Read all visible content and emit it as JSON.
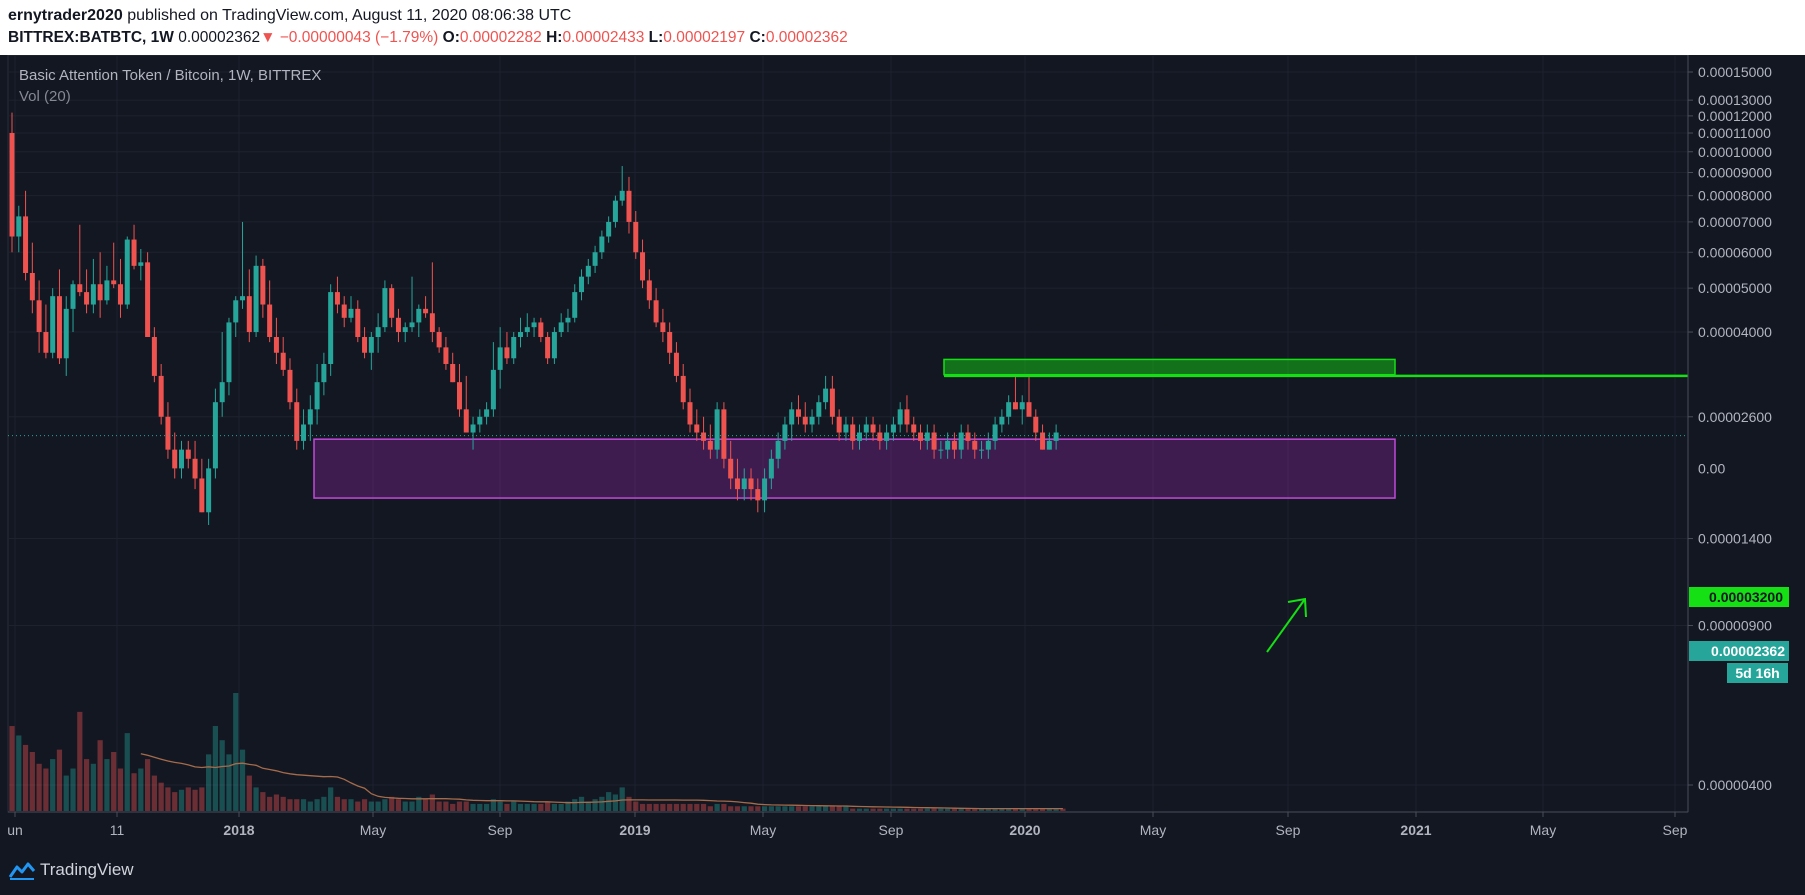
{
  "header": {
    "author": "ernytrader2020",
    "published_text": "published on TradingView.com, August 11, 2020 08:06:38 UTC",
    "symbol": "BITTREX:BATBTC, 1W",
    "price": "0.00002362",
    "change": "▼ −0.00000043 (−1.79%)",
    "open_label": "O:",
    "open": "0.00002282",
    "high_label": "H:",
    "high": "0.00002433",
    "low_label": "L:",
    "low": "0.00002197",
    "close_label": "C:",
    "close": "0.00002362"
  },
  "legend": {
    "title": "Basic Attention Token / Bitcoin, 1W, BITTREX",
    "volume": "Vol (20)"
  },
  "footer": {
    "brand": "TradingView",
    "icon": "tradingview-logo-icon"
  },
  "colors": {
    "up": "#26a69a",
    "down": "#ef5350",
    "resistance": "#14e014",
    "support_zone": "#9c27b0",
    "background": "#131722"
  },
  "chart_data": {
    "type": "candlestick",
    "scale": "log",
    "price_ticks": [
      "0.00015000",
      "0.00013000",
      "0.00012000",
      "0.00011000",
      "0.00010000",
      "0.00009000",
      "0.00008000",
      "0.00007000",
      "0.00006000",
      "0.00005000",
      "0.00004000",
      "0.00002600",
      "0.00001400",
      "0.00000900",
      "0.00000400"
    ],
    "time_ticks": [
      "un",
      "11",
      "2018",
      "May",
      "Sep",
      "2019",
      "May",
      "Sep",
      "2020",
      "May",
      "Sep",
      "2021",
      "May",
      "Sep"
    ],
    "last_price": "0.00002362",
    "countdown": "5d 16h",
    "resistance_level": "0.00003200",
    "support_zone": [
      1.72e-05,
      2.32e-05
    ],
    "resistance_zone": [
      3.22e-05,
      3.48e-05
    ],
    "candles": [
      [
        0.00011,
        0.000122,
        6e-05,
        6.5e-05
      ],
      [
        6.5e-05,
        7.6e-05,
        6e-05,
        7.2e-05
      ],
      [
        7.2e-05,
        8.2e-05,
        5.2e-05,
        5.4e-05
      ],
      [
        5.4e-05,
        6.3e-05,
        4.4e-05,
        4.7e-05
      ],
      [
        4.7e-05,
        5.2e-05,
        3.6e-05,
        4e-05
      ],
      [
        4e-05,
        4.6e-05,
        3.5e-05,
        3.6e-05
      ],
      [
        3.6e-05,
        5e-05,
        3.5e-05,
        4.8e-05
      ],
      [
        4.8e-05,
        5.5e-05,
        3.4e-05,
        3.5e-05
      ],
      [
        3.5e-05,
        4.8e-05,
        3.2e-05,
        4.5e-05
      ],
      [
        4.5e-05,
        5.2e-05,
        4e-05,
        5.1e-05
      ],
      [
        5.1e-05,
        6.9e-05,
        4.8e-05,
        4.9e-05
      ],
      [
        4.9e-05,
        5.5e-05,
        4.4e-05,
        4.6e-05
      ],
      [
        4.6e-05,
        5.8e-05,
        4.4e-05,
        5.1e-05
      ],
      [
        5.1e-05,
        6e-05,
        4.3e-05,
        4.7e-05
      ],
      [
        4.7e-05,
        5.6e-05,
        4.6e-05,
        5.2e-05
      ],
      [
        5.2e-05,
        6.3e-05,
        5e-05,
        5.1e-05
      ],
      [
        5.1e-05,
        5.8e-05,
        4.3e-05,
        4.6e-05
      ],
      [
        4.6e-05,
        6.5e-05,
        4.5e-05,
        6.4e-05
      ],
      [
        6.4e-05,
        6.9e-05,
        5.5e-05,
        5.6e-05
      ],
      [
        5.6e-05,
        6.1e-05,
        5.2e-05,
        5.7e-05
      ],
      [
        5.7e-05,
        6e-05,
        4.5e-05,
        3.9e-05
      ],
      [
        3.9e-05,
        4.1e-05,
        3.1e-05,
        3.2e-05
      ],
      [
        3.2e-05,
        3.4e-05,
        2.5e-05,
        2.6e-05
      ],
      [
        2.6e-05,
        2.8e-05,
        2.1e-05,
        2.2e-05
      ],
      [
        2.2e-05,
        2.4e-05,
        1.9e-05,
        2e-05
      ],
      [
        2e-05,
        2.3e-05,
        1.9e-05,
        2.2e-05
      ],
      [
        2.2e-05,
        2.3e-05,
        2e-05,
        2.1e-05
      ],
      [
        2.1e-05,
        2.3e-05,
        1.8e-05,
        1.9e-05
      ],
      [
        1.9e-05,
        2.1e-05,
        1.6e-05,
        1.6e-05
      ],
      [
        1.6e-05,
        2.1e-05,
        1.5e-05,
        2e-05
      ],
      [
        2e-05,
        3e-05,
        1.9e-05,
        2.8e-05
      ],
      [
        2.8e-05,
        4e-05,
        2.6e-05,
        3.1e-05
      ],
      [
        3.1e-05,
        4.3e-05,
        2.9e-05,
        4.2e-05
      ],
      [
        4.2e-05,
        4.8e-05,
        3.9e-05,
        4.7e-05
      ],
      [
        4.7e-05,
        7e-05,
        4.5e-05,
        4.8e-05
      ],
      [
        4.8e-05,
        5.5e-05,
        3.8e-05,
        4e-05
      ],
      [
        4e-05,
        5.9e-05,
        3.9e-05,
        5.6e-05
      ],
      [
        5.6e-05,
        5.8e-05,
        4.3e-05,
        4.6e-05
      ],
      [
        4.6e-05,
        5.2e-05,
        3.8e-05,
        3.9e-05
      ],
      [
        3.9e-05,
        4.3e-05,
        3.4e-05,
        3.6e-05
      ],
      [
        3.6e-05,
        3.9e-05,
        3.2e-05,
        3.3e-05
      ],
      [
        3.3e-05,
        3.5e-05,
        2.7e-05,
        2.8e-05
      ],
      [
        2.8e-05,
        3e-05,
        2.2e-05,
        2.3e-05
      ],
      [
        2.3e-05,
        2.7e-05,
        2.2e-05,
        2.5e-05
      ],
      [
        2.5e-05,
        2.9e-05,
        2.3e-05,
        2.7e-05
      ],
      [
        2.7e-05,
        3.4e-05,
        2.5e-05,
        3.1e-05
      ],
      [
        3.1e-05,
        3.6e-05,
        2.9e-05,
        3.4e-05
      ],
      [
        3.4e-05,
        5.1e-05,
        3.2e-05,
        4.9e-05
      ],
      [
        4.9e-05,
        5.3e-05,
        4.4e-05,
        4.6e-05
      ],
      [
        4.6e-05,
        4.8e-05,
        4.1e-05,
        4.3e-05
      ],
      [
        4.3e-05,
        4.8e-05,
        4.2e-05,
        4.5e-05
      ],
      [
        4.5e-05,
        4.7e-05,
        3.8e-05,
        3.9e-05
      ],
      [
        3.9e-05,
        4.1e-05,
        3.5e-05,
        3.6e-05
      ],
      [
        3.6e-05,
        4e-05,
        3.3e-05,
        3.9e-05
      ],
      [
        3.9e-05,
        4.4e-05,
        3.6e-05,
        4.1e-05
      ],
      [
        4.1e-05,
        5.2e-05,
        4e-05,
        5e-05
      ],
      [
        5e-05,
        5.1e-05,
        4.1e-05,
        4.3e-05
      ],
      [
        4.3e-05,
        4.5e-05,
        3.8e-05,
        4e-05
      ],
      [
        4e-05,
        4.2e-05,
        3.8e-05,
        4.1e-05
      ],
      [
        4.1e-05,
        5.3e-05,
        4e-05,
        4.2e-05
      ],
      [
        4.2e-05,
        4.6e-05,
        3.9e-05,
        4.5e-05
      ],
      [
        4.5e-05,
        4.8e-05,
        4.3e-05,
        4.4e-05
      ],
      [
        4.4e-05,
        5.7e-05,
        3.8e-05,
        4e-05
      ],
      [
        4e-05,
        4.1e-05,
        3.6e-05,
        3.7e-05
      ],
      [
        3.7e-05,
        3.9e-05,
        3.3e-05,
        3.4e-05
      ],
      [
        3.4e-05,
        3.6e-05,
        3.1e-05,
        3.1e-05
      ],
      [
        3.1e-05,
        3.4e-05,
        2.6e-05,
        2.7e-05
      ],
      [
        2.7e-05,
        3.2e-05,
        2.5e-05,
        2.4e-05
      ],
      [
        2.4e-05,
        2.6e-05,
        2.2e-05,
        2.5e-05
      ],
      [
        2.5e-05,
        2.7e-05,
        2.4e-05,
        2.6e-05
      ],
      [
        2.6e-05,
        2.8e-05,
        2.5e-05,
        2.7e-05
      ],
      [
        2.7e-05,
        3.8e-05,
        2.6e-05,
        3.3e-05
      ],
      [
        3.3e-05,
        4.1e-05,
        3e-05,
        3.7e-05
      ],
      [
        3.7e-05,
        4e-05,
        3.4e-05,
        3.5e-05
      ],
      [
        3.5e-05,
        4e-05,
        3.4e-05,
        3.9e-05
      ],
      [
        3.9e-05,
        4.3e-05,
        3.7e-05,
        4e-05
      ],
      [
        4e-05,
        4.4e-05,
        3.9e-05,
        4.1e-05
      ],
      [
        4.1e-05,
        4.3e-05,
        3.9e-05,
        4.2e-05
      ],
      [
        4.2e-05,
        4.3e-05,
        3.8e-05,
        3.9e-05
      ],
      [
        3.9e-05,
        4e-05,
        3.4e-05,
        3.5e-05
      ],
      [
        3.5e-05,
        4.1e-05,
        3.4e-05,
        4e-05
      ],
      [
        4e-05,
        4.4e-05,
        3.9e-05,
        4.2e-05
      ],
      [
        4.2e-05,
        4.5e-05,
        4e-05,
        4.3e-05
      ],
      [
        4.3e-05,
        5.1e-05,
        4.2e-05,
        4.9e-05
      ],
      [
        4.9e-05,
        5.5e-05,
        4.7e-05,
        5.3e-05
      ],
      [
        5.3e-05,
        5.8e-05,
        5.1e-05,
        5.6e-05
      ],
      [
        5.6e-05,
        6.2e-05,
        5.4e-05,
        6e-05
      ],
      [
        6e-05,
        6.7e-05,
        5.8e-05,
        6.5e-05
      ],
      [
        6.5e-05,
        7.2e-05,
        6.3e-05,
        7e-05
      ],
      [
        7e-05,
        8e-05,
        6.8e-05,
        7.8e-05
      ],
      [
        7.8e-05,
        9.3e-05,
        7.6e-05,
        8.2e-05
      ],
      [
        8.2e-05,
        8.8e-05,
        6.6e-05,
        7e-05
      ],
      [
        7e-05,
        7.4e-05,
        5.8e-05,
        6e-05
      ],
      [
        6e-05,
        6.4e-05,
        5e-05,
        5.2e-05
      ],
      [
        5.2e-05,
        5.5e-05,
        4.5e-05,
        4.7e-05
      ],
      [
        4.7e-05,
        5e-05,
        4.1e-05,
        4.2e-05
      ],
      [
        4.2e-05,
        4.5e-05,
        3.8e-05,
        4e-05
      ],
      [
        4e-05,
        4.2e-05,
        3.4e-05,
        3.6e-05
      ],
      [
        3.6e-05,
        3.8e-05,
        3.1e-05,
        3.2e-05
      ],
      [
        3.2e-05,
        3.4e-05,
        2.7e-05,
        2.8e-05
      ],
      [
        2.8e-05,
        3e-05,
        2.4e-05,
        2.5e-05
      ],
      [
        2.5e-05,
        2.7e-05,
        2.3e-05,
        2.4e-05
      ],
      [
        2.4e-05,
        2.6e-05,
        2.2e-05,
        2.3e-05
      ],
      [
        2.3e-05,
        2.5e-05,
        2.1e-05,
        2.2e-05
      ],
      [
        2.2e-05,
        2.8e-05,
        2.1e-05,
        2.7e-05
      ],
      [
        2.7e-05,
        2.8e-05,
        2e-05,
        2.1e-05
      ],
      [
        2.1e-05,
        2.3e-05,
        1.8e-05,
        1.9e-05
      ],
      [
        1.9e-05,
        2.1e-05,
        1.7e-05,
        1.8e-05
      ],
      [
        1.8e-05,
        2e-05,
        1.7e-05,
        1.9e-05
      ],
      [
        1.9e-05,
        2e-05,
        1.7e-05,
        1.8e-05
      ],
      [
        1.8e-05,
        1.9e-05,
        1.6e-05,
        1.7e-05
      ],
      [
        1.7e-05,
        2e-05,
        1.6e-05,
        1.9e-05
      ],
      [
        1.9e-05,
        2.2e-05,
        1.8e-05,
        2.1e-05
      ],
      [
        2.1e-05,
        2.4e-05,
        2e-05,
        2.3e-05
      ],
      [
        2.3e-05,
        2.6e-05,
        2.2e-05,
        2.5e-05
      ],
      [
        2.5e-05,
        2.8e-05,
        2.3e-05,
        2.7e-05
      ],
      [
        2.7e-05,
        2.9e-05,
        2.5e-05,
        2.6e-05
      ],
      [
        2.6e-05,
        2.8e-05,
        2.4e-05,
        2.5e-05
      ],
      [
        2.5e-05,
        2.7e-05,
        2.4e-05,
        2.6e-05
      ],
      [
        2.6e-05,
        2.9e-05,
        2.5e-05,
        2.8e-05
      ],
      [
        2.8e-05,
        3.2e-05,
        2.7e-05,
        3e-05
      ],
      [
        3e-05,
        3.2e-05,
        2.5e-05,
        2.6e-05
      ],
      [
        2.6e-05,
        2.7e-05,
        2.3e-05,
        2.4e-05
      ],
      [
        2.4e-05,
        2.6e-05,
        2.3e-05,
        2.5e-05
      ],
      [
        2.5e-05,
        2.6e-05,
        2.2e-05,
        2.3e-05
      ],
      [
        2.3e-05,
        2.5e-05,
        2.2e-05,
        2.4e-05
      ],
      [
        2.4e-05,
        2.6e-05,
        2.3e-05,
        2.5e-05
      ],
      [
        2.5e-05,
        2.6e-05,
        2.3e-05,
        2.4e-05
      ],
      [
        2.4e-05,
        2.5e-05,
        2.2e-05,
        2.3e-05
      ],
      [
        2.3e-05,
        2.5e-05,
        2.2e-05,
        2.4e-05
      ],
      [
        2.4e-05,
        2.6e-05,
        2.3e-05,
        2.5e-05
      ],
      [
        2.5e-05,
        2.8e-05,
        2.4e-05,
        2.7e-05
      ],
      [
        2.7e-05,
        2.9e-05,
        2.4e-05,
        2.5e-05
      ],
      [
        2.5e-05,
        2.6e-05,
        2.3e-05,
        2.4e-05
      ],
      [
        2.4e-05,
        2.5e-05,
        2.2e-05,
        2.3e-05
      ],
      [
        2.3e-05,
        2.5e-05,
        2.2e-05,
        2.4e-05
      ],
      [
        2.4e-05,
        2.5e-05,
        2.1e-05,
        2.2e-05
      ],
      [
        2.2e-05,
        2.3e-05,
        2.1e-05,
        2.2e-05
      ],
      [
        2.2e-05,
        2.4e-05,
        2.1e-05,
        2.3e-05
      ],
      [
        2.3e-05,
        2.4e-05,
        2.1e-05,
        2.2e-05
      ],
      [
        2.2e-05,
        2.5e-05,
        2.1e-05,
        2.4e-05
      ],
      [
        2.4e-05,
        2.5e-05,
        2.2e-05,
        2.3e-05
      ],
      [
        2.3e-05,
        2.4e-05,
        2.1e-05,
        2.2e-05
      ],
      [
        2.2e-05,
        2.3e-05,
        2.1e-05,
        2.2e-05
      ],
      [
        2.2e-05,
        2.4e-05,
        2.1e-05,
        2.3e-05
      ],
      [
        2.3e-05,
        2.6e-05,
        2.2e-05,
        2.5e-05
      ],
      [
        2.5e-05,
        2.7e-05,
        2.4e-05,
        2.6e-05
      ],
      [
        2.6e-05,
        2.9e-05,
        2.5e-05,
        2.8e-05
      ],
      [
        2.8e-05,
        3.2e-05,
        2.7e-05,
        2.7e-05
      ],
      [
        2.7e-05,
        2.9e-05,
        2.5e-05,
        2.8e-05
      ],
      [
        2.8e-05,
        3.2e-05,
        2.7e-05,
        2.6e-05
      ],
      [
        2.6e-05,
        2.7e-05,
        2.3e-05,
        2.4e-05
      ],
      [
        2.4e-05,
        2.5e-05,
        2.2e-05,
        2.2e-05
      ],
      [
        2.2e-05,
        2.4e-05,
        2.2e-05,
        2.3e-05
      ],
      [
        2.3e-05,
        2.5e-05,
        2.2e-05,
        2.4e-05
      ]
    ],
    "volumes": [
      36,
      32,
      28,
      25,
      20,
      18,
      22,
      26,
      15,
      18,
      42,
      22,
      20,
      30,
      22,
      25,
      18,
      33,
      16,
      18,
      22,
      15,
      12,
      10,
      8,
      9,
      10,
      9,
      10,
      24,
      36,
      30,
      24,
      50,
      26,
      15,
      10,
      8,
      6,
      7,
      6,
      5,
      5,
      5,
      4,
      5,
      6,
      10,
      6,
      5,
      5,
      4,
      5,
      4,
      4,
      5,
      6,
      5,
      4,
      4,
      6,
      5,
      7,
      4,
      4,
      3,
      4,
      4,
      3,
      3,
      3,
      5,
      4,
      3,
      4,
      3,
      3,
      3,
      3,
      4,
      3,
      3,
      4,
      5,
      6,
      4,
      5,
      6,
      8,
      7,
      10,
      6,
      4,
      3,
      3,
      3,
      3,
      3,
      3,
      3,
      3,
      3,
      3,
      2,
      3,
      3,
      2,
      2,
      2,
      2,
      2,
      2,
      2,
      2,
      2,
      2,
      2,
      2,
      2,
      2,
      2,
      2,
      2,
      2,
      1,
      1,
      1,
      1,
      1,
      1,
      1,
      1,
      1,
      1,
      1,
      1,
      1,
      1,
      1,
      1,
      1,
      1,
      1,
      1,
      1,
      1,
      1,
      1,
      1,
      1,
      1,
      1,
      1,
      1,
      1,
      1
    ]
  }
}
